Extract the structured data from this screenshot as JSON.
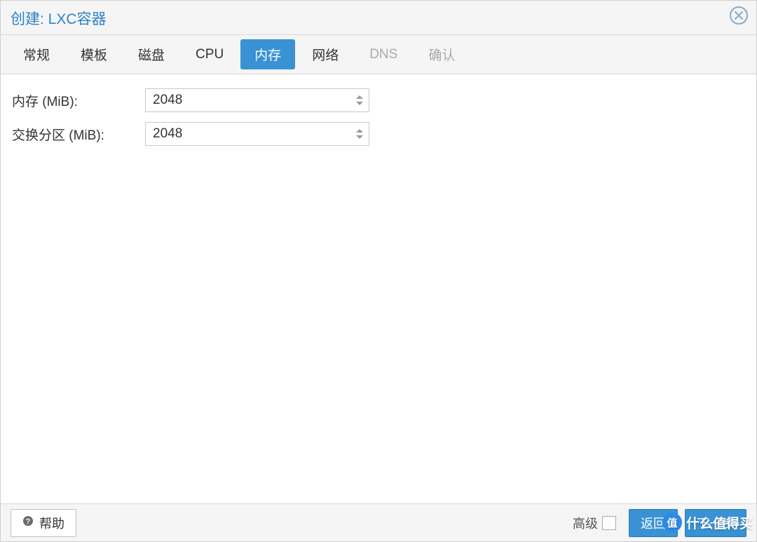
{
  "dialog": {
    "title": "创建: LXC容器"
  },
  "tabs": [
    {
      "label": "常规",
      "active": false,
      "disabled": false
    },
    {
      "label": "模板",
      "active": false,
      "disabled": false
    },
    {
      "label": "磁盘",
      "active": false,
      "disabled": false
    },
    {
      "label": "CPU",
      "active": false,
      "disabled": false
    },
    {
      "label": "内存",
      "active": true,
      "disabled": false
    },
    {
      "label": "网络",
      "active": false,
      "disabled": false
    },
    {
      "label": "DNS",
      "active": false,
      "disabled": true
    },
    {
      "label": "确认",
      "active": false,
      "disabled": true
    }
  ],
  "form": {
    "memory": {
      "label": "内存 (MiB):",
      "value": "2048"
    },
    "swap": {
      "label": "交换分区 (MiB):",
      "value": "2048"
    }
  },
  "footer": {
    "help_label": "帮助",
    "advanced_label": "高级",
    "advanced_checked": false,
    "back_label": "返回",
    "next_label": "下一步"
  },
  "watermark": {
    "badge": "值",
    "text": "什么值得买"
  },
  "colors": {
    "accent": "#3892d4",
    "title": "#2e83c8",
    "panel_bg": "#f5f5f5",
    "border": "#d8d8d8"
  }
}
